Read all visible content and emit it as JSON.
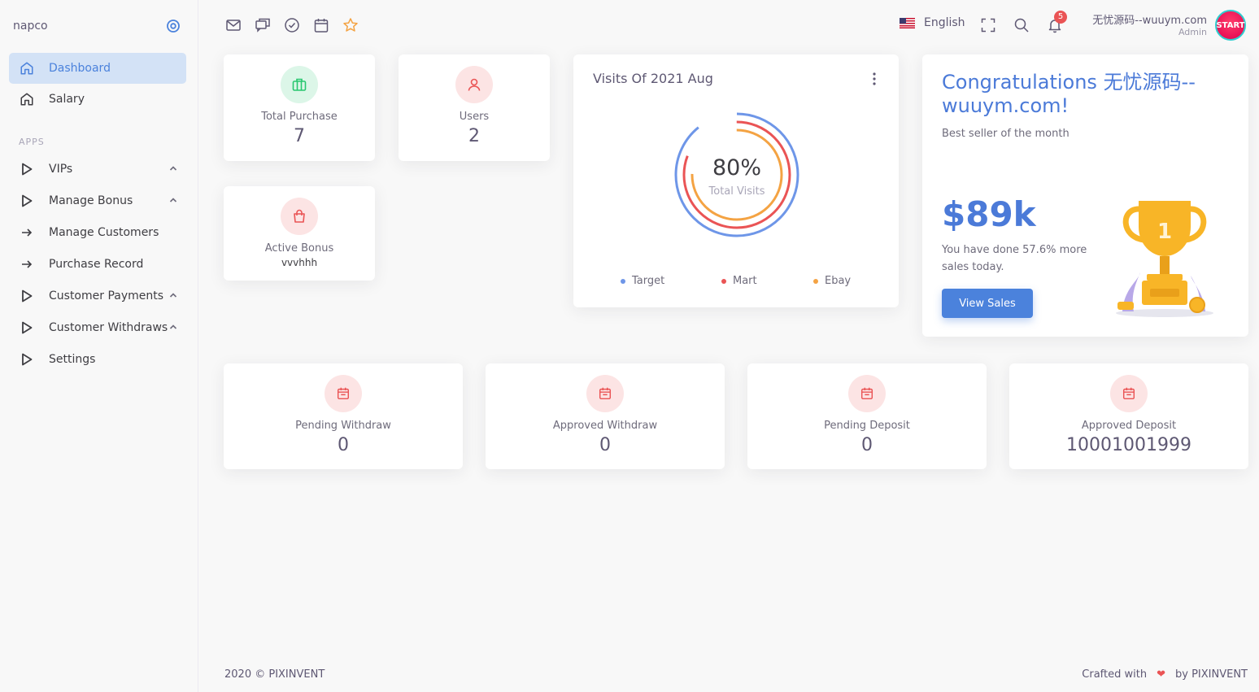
{
  "sidebar": {
    "brand": "napco",
    "items": [
      {
        "label": "Dashboard",
        "icon": "home-icon",
        "active": true
      },
      {
        "label": "Salary",
        "icon": "home-icon"
      }
    ],
    "section_label": "APPS",
    "apps": [
      {
        "label": "VIPs",
        "icon": "play-icon",
        "expandable": true
      },
      {
        "label": "Manage Bonus",
        "icon": "play-icon",
        "expandable": true
      },
      {
        "label": "Manage Customers",
        "icon": "arrow-right-icon"
      },
      {
        "label": "Purchase Record",
        "icon": "arrow-right-icon"
      },
      {
        "label": "Customer Payments",
        "icon": "play-icon",
        "expandable": true
      },
      {
        "label": "Customer Withdraws",
        "icon": "play-icon",
        "expandable": true
      },
      {
        "label": "Settings",
        "icon": "play-icon"
      }
    ]
  },
  "header": {
    "language": "English",
    "notifications": "5",
    "user_name": "无忧源码--wuuym.com",
    "user_role": "Admin",
    "avatar_text": "START"
  },
  "stats": {
    "total_purchase": {
      "label": "Total Purchase",
      "value": "7"
    },
    "users": {
      "label": "Users",
      "value": "2"
    },
    "active_bonus": {
      "label": "Active Bonus",
      "value": "vvvhhh"
    },
    "pending_withdraw": {
      "label": "Pending Withdraw",
      "value": "0"
    },
    "approved_withdraw": {
      "label": "Approved Withdraw",
      "value": "0"
    },
    "pending_deposit": {
      "label": "Pending Deposit",
      "value": "0"
    },
    "approved_deposit": {
      "label": "Approved Deposit",
      "value": "10001001999"
    }
  },
  "visits": {
    "title": "Visits Of 2021 Aug",
    "percent": "80%",
    "center_label": "Total Visits",
    "legend": [
      {
        "name": "Target",
        "color": "#6e96e8"
      },
      {
        "name": "Mart",
        "color": "#ea5455"
      },
      {
        "name": "Ebay",
        "color": "#f4a343"
      }
    ]
  },
  "congrats": {
    "title": "Congratulations 无忧源码--wuuym.com!",
    "subtitle": "Best seller of the month",
    "amount": "$89k",
    "description": "You have done 57.6% more sales today.",
    "button": "View Sales",
    "trophy_number": "1"
  },
  "footer": {
    "copyright": "2020 © PIXINVENT",
    "crafted": "Crafted with",
    "by": "by PIXINVENT"
  },
  "colors": {
    "primary": "#4b82dc",
    "danger": "#ea5455",
    "success": "#28c76f",
    "warning": "#f4a343"
  }
}
